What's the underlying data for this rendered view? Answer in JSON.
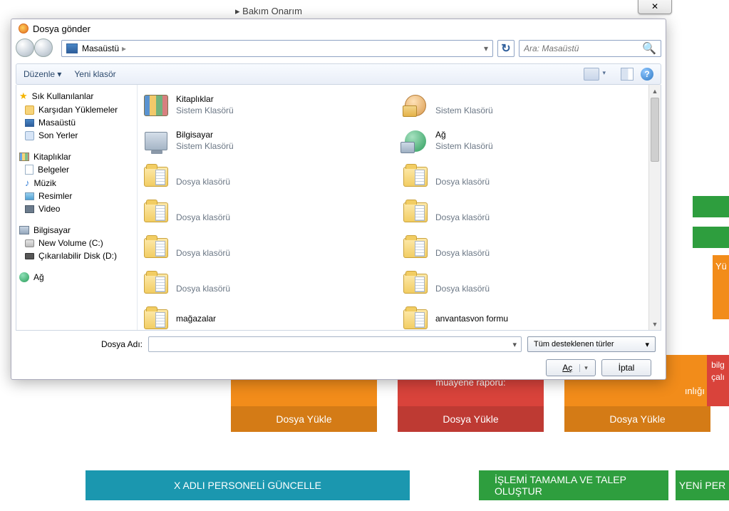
{
  "page": {
    "breadcrumb_arrow": "▸",
    "breadcrumb": "Bakım Onarım"
  },
  "cards": {
    "c1_title": "",
    "c2_body": "raporu\" veya işyeri hekimi muayene raporu:",
    "c3_tail": "ınlığı",
    "c4_body": "bilg çalı",
    "upload": "Dosya Yükle"
  },
  "orange_slab": "Yü",
  "buttons": {
    "update": "X ADLI PERSONELİ GÜNCELLE",
    "submit": "İŞLEMİ TAMAMLA VE TALEP OLUŞTUR",
    "new": "YENİ PER"
  },
  "dialog": {
    "title": "Dosya gönder",
    "close": "✕",
    "address": {
      "root": "Masaüstü",
      "arrow": "▸",
      "dd": "▾"
    },
    "refresh": "↻",
    "search_placeholder": "Ara: Masaüstü",
    "toolbar": {
      "organize": "Düzenle ▾",
      "newfolder": "Yeni klasör",
      "help": "?"
    },
    "tree": {
      "fav": "Sık Kullanılanlar",
      "downloads": "Karşıdan Yüklemeler",
      "desktop": "Masaüstü",
      "recent": "Son Yerler",
      "libs": "Kitaplıklar",
      "docs": "Belgeler",
      "music": "Müzik",
      "pics": "Resimler",
      "video": "Video",
      "computer": "Bilgisayar",
      "drive_c": "New Volume (C:)",
      "drive_d": "Çıkarılabilir Disk (D:)",
      "network": "Ağ"
    },
    "types": {
      "system_folder": "Sistem Klasörü",
      "file_folder": "Dosya klasörü"
    },
    "items": {
      "libraries": "Kitaplıklar",
      "computer": "Bilgisayar",
      "network": "Ağ",
      "last_left": "mağazalar",
      "last_right": "anvantasvon formu"
    },
    "footer": {
      "filename_label": "Dosya Adı:",
      "filter": "Tüm desteklenen türler",
      "open": "Aç",
      "cancel": "İptal",
      "dd": "▾"
    }
  }
}
